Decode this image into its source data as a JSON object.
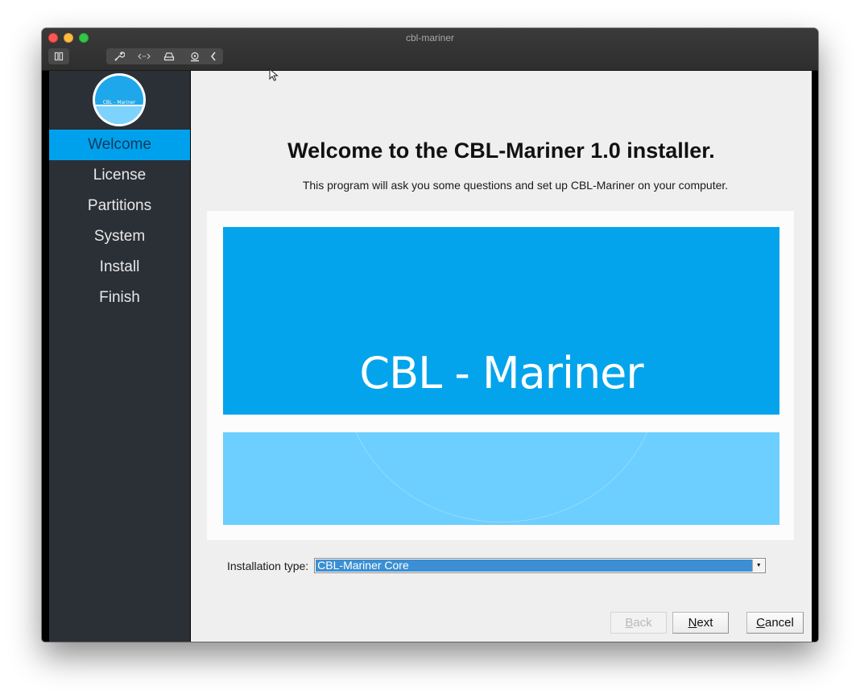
{
  "window": {
    "title": "cbl-mariner",
    "traffic_lights": [
      "close",
      "minimize",
      "maximize"
    ],
    "toolbar": {
      "sidebar_toggle_icon": "sidebar-toggle-icon",
      "group_icons": [
        "wrench-icon",
        "code-arrows-icon",
        "drive-icon",
        "webcam-icon",
        "chevron-left-icon"
      ]
    }
  },
  "sidebar": {
    "logo_text": "CBL - Mariner",
    "items": [
      {
        "label": "Welcome",
        "active": true
      },
      {
        "label": "License",
        "active": false
      },
      {
        "label": "Partitions",
        "active": false
      },
      {
        "label": "System",
        "active": false
      },
      {
        "label": "Install",
        "active": false
      },
      {
        "label": "Finish",
        "active": false
      }
    ]
  },
  "main": {
    "heading": "Welcome to the CBL-Mariner 1.0 installer.",
    "subheading": "This program will ask you some questions and set up CBL-Mariner on your computer.",
    "banner_text": "CBL - Mariner",
    "installation_type": {
      "label": "Installation type:",
      "selected": "CBL-Mariner Core"
    },
    "buttons": {
      "back": {
        "label": "Back",
        "mnemonic": "B",
        "rest": "ack",
        "enabled": false
      },
      "next": {
        "label": "Next",
        "mnemonic": "N",
        "rest": "ext",
        "enabled": true
      },
      "cancel": {
        "label": "Cancel",
        "mnemonic": "C",
        "rest": "ancel",
        "enabled": true
      }
    }
  },
  "colors": {
    "accent": "#00a1ec",
    "sidebar_bg": "#2b2f36",
    "banner_top": "#03a4ec",
    "banner_bottom": "#6ccfff",
    "selection": "#3b8fd2"
  }
}
